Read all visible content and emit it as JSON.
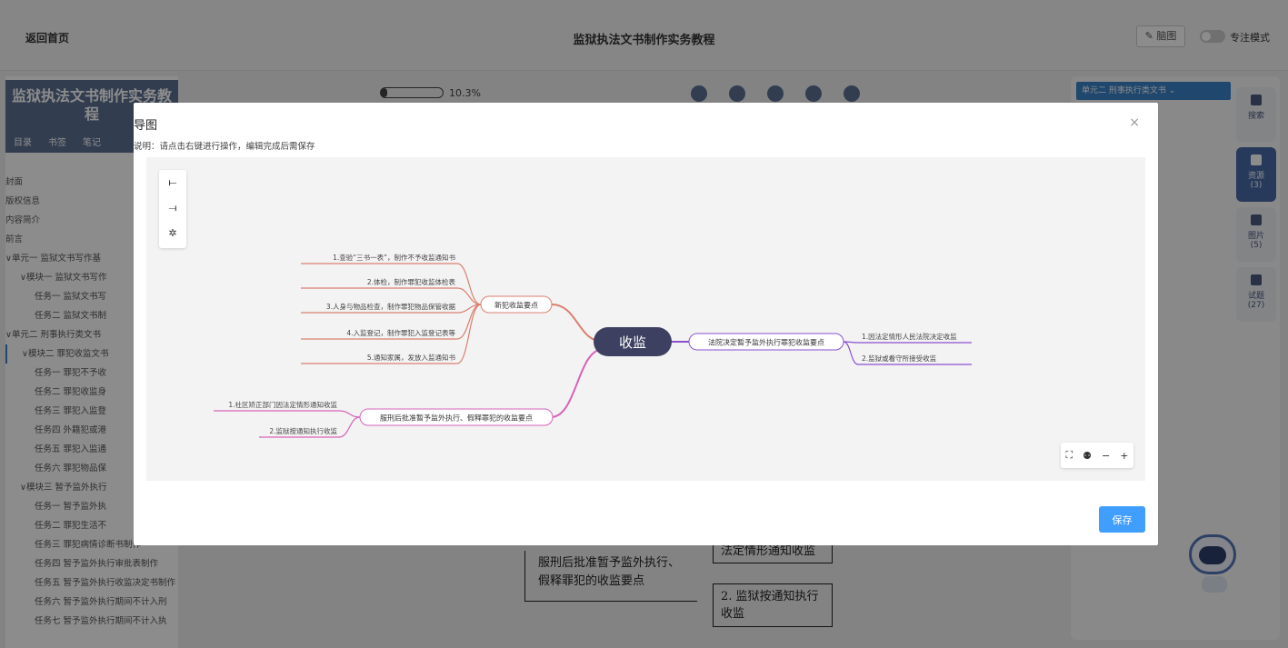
{
  "topbar": {
    "back": "返回首页",
    "title": "监狱执法文书制作实务教程",
    "mindmap": "脑图",
    "focus_mode": "专注模式"
  },
  "left": {
    "book_title": "监狱执法文书制作实务教程",
    "tabs": [
      "目录",
      "书签",
      "笔记"
    ],
    "toc": [
      "封面",
      "版权信息",
      "内容简介",
      "前言",
      "∨单元一 监狱文书写作基",
      "∨模块一 监狱文书写作",
      "任务一 监狱文书写",
      "任务二 监狱文书制",
      "∨单元二 刑事执行类文书",
      "∨模块二 罪犯收监文书",
      "任务一 罪犯不予收",
      "任务二 罪犯收监身",
      "任务三 罪犯入监登",
      "任务四 外籍犯或港",
      "任务五 罪犯入监通",
      "任务六 罪犯物品保",
      "∨模块三 暂予监外执行",
      "任务一 暂予监外执",
      "任务二 罪犯生活不",
      "任务三 罪犯病情诊断书制作",
      "任务四 暂予监外执行审批表制作",
      "任务五 暂予监外执行收监决定书制作",
      "任务六 暂予监外执行期间不计入刑",
      "任务七 暂予监外执行期间不计入执"
    ]
  },
  "progress": {
    "text": "10.3%",
    "value": 0.103
  },
  "right": {
    "unit_select": "单元二 刑事执行类文书",
    "tabs": [
      {
        "label": "搜索",
        "count": ""
      },
      {
        "label": "资源",
        "count": "(3)"
      },
      {
        "label": "图片",
        "count": "(5)"
      },
      {
        "label": "试题",
        "count": "(27)"
      }
    ]
  },
  "background_map": {
    "node_main": "服刑后批准暂予监外执行、假释罪犯的收监要点",
    "node_1": "法定情形通知收监",
    "node_2": "2. 监狱按通知执行收监"
  },
  "modal": {
    "title": "导图",
    "description": "说明：请点击右键进行操作，编辑完成后需保存",
    "close": "×",
    "save": "保存",
    "toolbox": [
      "⟝",
      "⟞",
      "✲"
    ],
    "zoom": [
      "⛶",
      "⚉",
      "−",
      "+"
    ]
  },
  "mindmap": {
    "root": "收监",
    "branch_a": {
      "label": "新犯收监要点",
      "items": [
        "1.查验“三书一表”，制作不予收监通知书",
        "2.体检，制作罪犯收监体检表",
        "3.人身与物品检查，制作罪犯物品保管收据",
        "4.入监登记，制作罪犯入监登记表等",
        "5.通知家属，发放入监通知书"
      ]
    },
    "branch_b": {
      "label": "服刑后批准暂予监外执行、假释罪犯的收监要点",
      "items": [
        "1.社区矫正部门因法定情形通知收监",
        "2.监狱按通知执行收监"
      ]
    },
    "branch_c": {
      "label": "法院决定暂予监外执行罪犯收监要点",
      "items": [
        "1.因法定情形人民法院决定收监",
        "2.监狱或看守所接受收监"
      ]
    },
    "colors": {
      "branch_a": "#d98070",
      "branch_b": "#d763b8",
      "branch_c": "#8a4fd0",
      "root_bg": "#3d4060"
    }
  }
}
